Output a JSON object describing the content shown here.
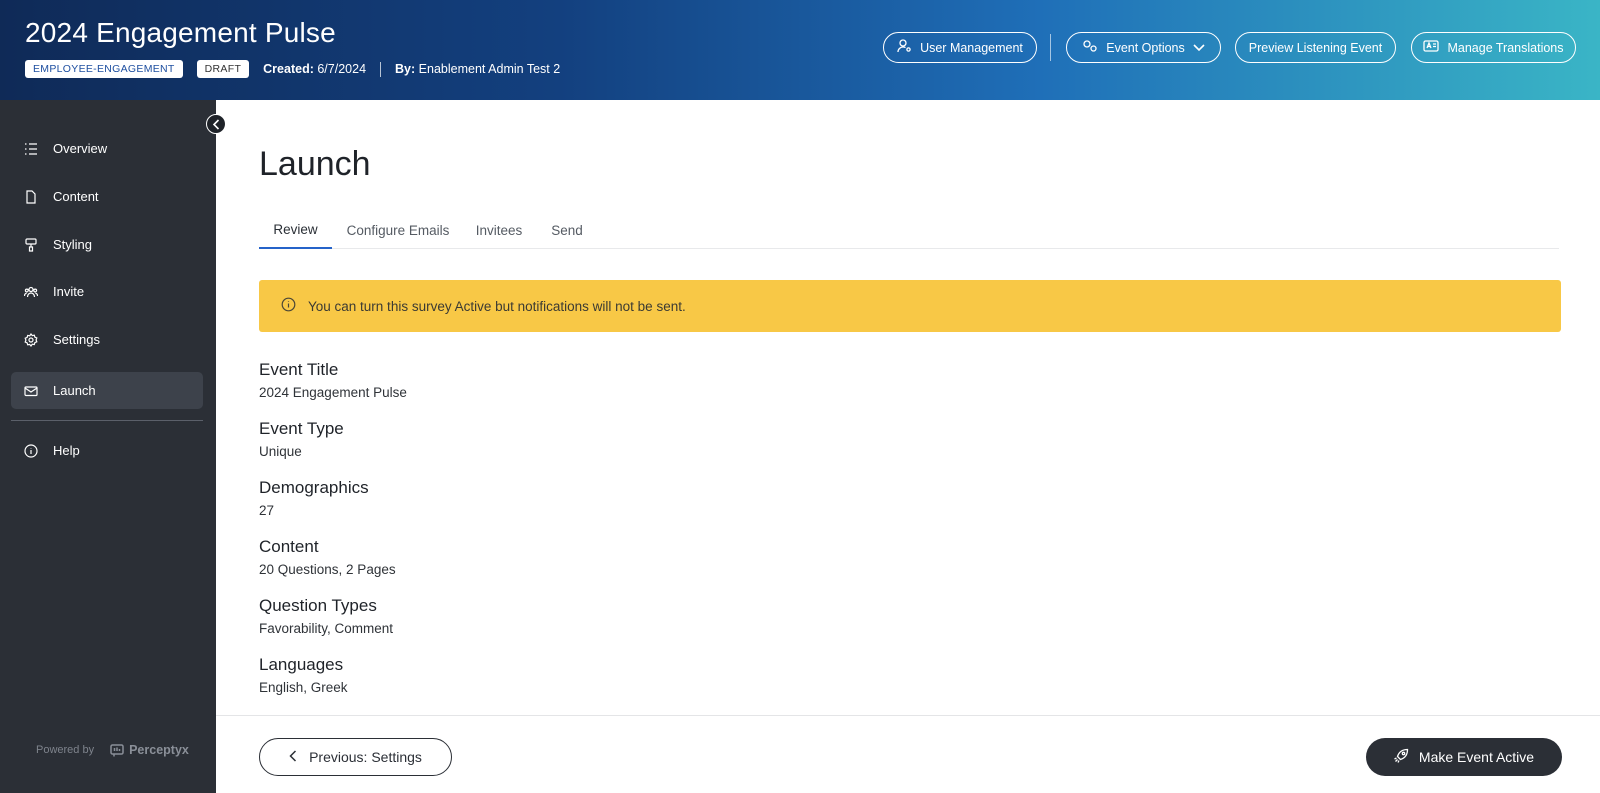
{
  "header": {
    "title": "2024 Engagement Pulse",
    "tag": "EMPLOYEE-ENGAGEMENT",
    "status": "DRAFT",
    "created_label": "Created:",
    "created_value": "6/7/2024",
    "by_label": "By:",
    "by_value": "Enablement Admin Test 2",
    "buttons": {
      "user_management": "User Management",
      "event_options": "Event Options",
      "preview": "Preview Listening Event",
      "translations": "Manage Translations"
    }
  },
  "sidebar": {
    "items": [
      {
        "label": "Overview",
        "icon": "list-icon"
      },
      {
        "label": "Content",
        "icon": "document-icon"
      },
      {
        "label": "Styling",
        "icon": "paint-roller-icon"
      },
      {
        "label": "Invite",
        "icon": "users-icon"
      },
      {
        "label": "Settings",
        "icon": "gear-icon"
      },
      {
        "label": "Launch",
        "icon": "envelope-icon",
        "active": true
      }
    ],
    "help": "Help",
    "powered_by": "Powered by",
    "brand": "Perceptyx"
  },
  "main": {
    "title": "Launch",
    "tabs": [
      "Review",
      "Configure Emails",
      "Invitees",
      "Send"
    ],
    "active_tab": "Review",
    "alert": "You can turn this survey Active but notifications will not be sent.",
    "fields": [
      {
        "label": "Event Title",
        "value": "2024 Engagement Pulse"
      },
      {
        "label": "Event Type",
        "value": "Unique"
      },
      {
        "label": "Demographics",
        "value": "27"
      },
      {
        "label": "Content",
        "value": "20 Questions, 2 Pages"
      },
      {
        "label": "Question Types",
        "value": "Favorability, Comment"
      },
      {
        "label": "Languages",
        "value": "English, Greek"
      }
    ]
  },
  "footer": {
    "previous": "Previous: Settings",
    "make_active": "Make Event Active"
  },
  "colors": {
    "alert_bg": "#f8c846",
    "sidebar_bg": "#2b2f36",
    "tab_accent": "#2563c9"
  }
}
